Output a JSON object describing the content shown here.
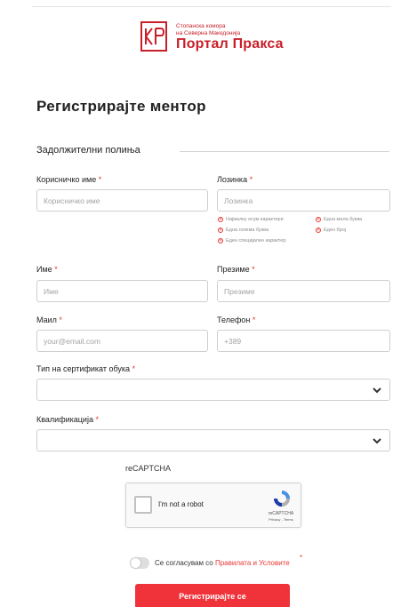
{
  "logo": {
    "small_text": "Стопанска комора\nна Северна Македонија",
    "big_text": "Портал Пракса"
  },
  "page_title": "Регистрирајте ментор",
  "section_title": "Задолжителни полиња",
  "fields": {
    "username": {
      "label": "Корисничко име",
      "placeholder": "Корисничко име"
    },
    "password": {
      "label": "Лозинка",
      "placeholder": "Лозинка"
    },
    "first_name": {
      "label": "Име",
      "placeholder": "Име"
    },
    "last_name": {
      "label": "Презиме",
      "placeholder": "Презиме"
    },
    "email": {
      "label": "Маил",
      "placeholder": "your@email.com"
    },
    "phone": {
      "label": "Телефон",
      "placeholder": "+389"
    },
    "certificate_type": {
      "label": "Тип на сертификат обука",
      "value": ""
    },
    "qualification": {
      "label": "Квалификација",
      "value": ""
    }
  },
  "required_marker": "*",
  "password_rules": [
    "Најмалку осум карактери",
    "Една мала буква",
    "Една голема буква",
    "Еден број",
    "Еден специјален карактер"
  ],
  "captcha": {
    "title": "reCAPTCHA",
    "label": "I'm not a robot",
    "brand": "reCAPTCHA",
    "links": "Privacy - Terms"
  },
  "terms": {
    "prefix": "Се согласувам со ",
    "link": "Правилата и Условите",
    "enabled": false
  },
  "submit_label": "Регистрирајте се",
  "colors": {
    "brand_red": "#c8202a",
    "button_red": "#f0333b",
    "required_red": "#e53935"
  }
}
